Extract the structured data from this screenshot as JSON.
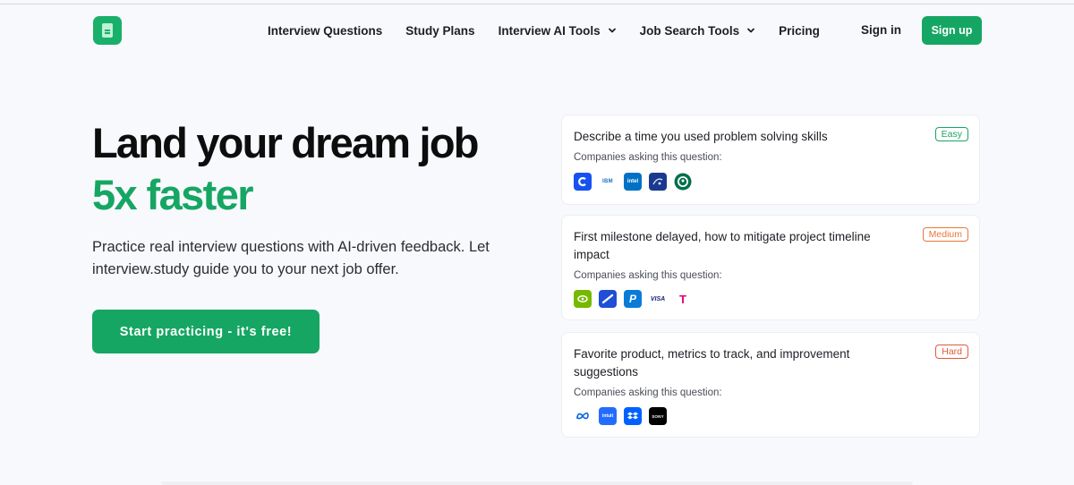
{
  "nav": {
    "links": [
      {
        "label": "Interview Questions",
        "dropdown": false
      },
      {
        "label": "Study Plans",
        "dropdown": false
      },
      {
        "label": "Interview AI Tools",
        "dropdown": true
      },
      {
        "label": "Job Search Tools",
        "dropdown": true
      },
      {
        "label": "Pricing",
        "dropdown": false
      }
    ],
    "signin": "Sign in",
    "signup": "Sign up"
  },
  "hero": {
    "title": "Land your dream job",
    "accent": "5x faster",
    "description": "Practice real interview questions with AI-driven feedback. Let interview.study guide you to your next job offer.",
    "cta": "Start practicing - it's free!"
  },
  "colors": {
    "brand_green": "#16a663",
    "easy": "#16a663",
    "medium": "#e8773a",
    "hard": "#e05a3a"
  },
  "cards": [
    {
      "question": "Describe a time you used problem solving skills",
      "difficulty": "Easy",
      "subtitle": "Companies asking this question:",
      "companies": [
        "coinbase-logo-icon",
        "ibm-logo-icon",
        "intel-logo-icon",
        "pepsico-logo-icon",
        "starbucks-logo-icon"
      ]
    },
    {
      "question": "First milestone delayed, how to mitigate project timeline impact",
      "difficulty": "Medium",
      "subtitle": "Companies asking this question:",
      "companies": [
        "nvidia-logo-icon",
        "airline-logo-icon",
        "paypal-logo-icon",
        "visa-logo-icon",
        "tmobile-logo-icon"
      ]
    },
    {
      "question": "Favorite product, metrics to track, and improvement suggestions",
      "difficulty": "Hard",
      "subtitle": "Companies asking this question:",
      "companies": [
        "meta-logo-icon",
        "intuit-logo-icon",
        "dropbox-logo-icon",
        "sony-logo-icon"
      ]
    }
  ]
}
